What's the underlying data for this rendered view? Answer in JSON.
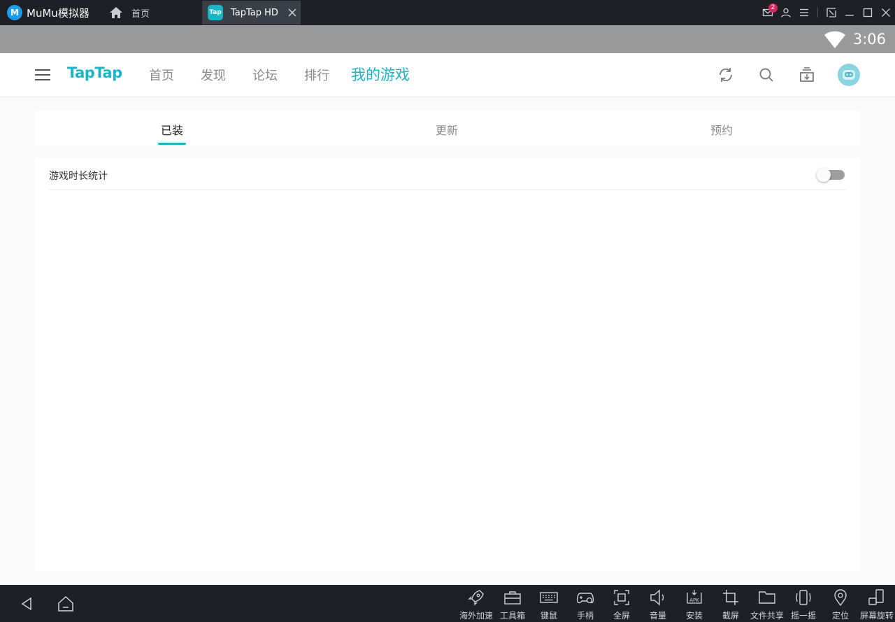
{
  "titlebar": {
    "app_name": "MuMu模拟器",
    "home_tab": "首页",
    "active_tab": "TapTap HD",
    "active_tab_icon": "Tap",
    "mail_count": "2"
  },
  "statusbar": {
    "time": "3:06"
  },
  "header": {
    "logo": "TapTap",
    "nav": [
      "首页",
      "发现",
      "论坛",
      "排行",
      "我的游戏"
    ],
    "active_nav": "我的游戏"
  },
  "subtabs": {
    "items": [
      "已装",
      "更新",
      "预约"
    ],
    "active": "已装"
  },
  "content": {
    "playtime_stats_label": "游戏时长统计",
    "playtime_stats_enabled": false
  },
  "toolbar": {
    "items": [
      "海外加速",
      "工具箱",
      "键鼠",
      "手柄",
      "全屏",
      "音量",
      "安装",
      "截屏",
      "文件共享",
      "摇一摇",
      "定位",
      "屏幕旋转"
    ]
  },
  "colors": {
    "accent": "#1bb5c6",
    "titlebar_bg": "#1e2025",
    "statusbar_bg": "#9a9a9a",
    "badge": "#e0245e"
  }
}
